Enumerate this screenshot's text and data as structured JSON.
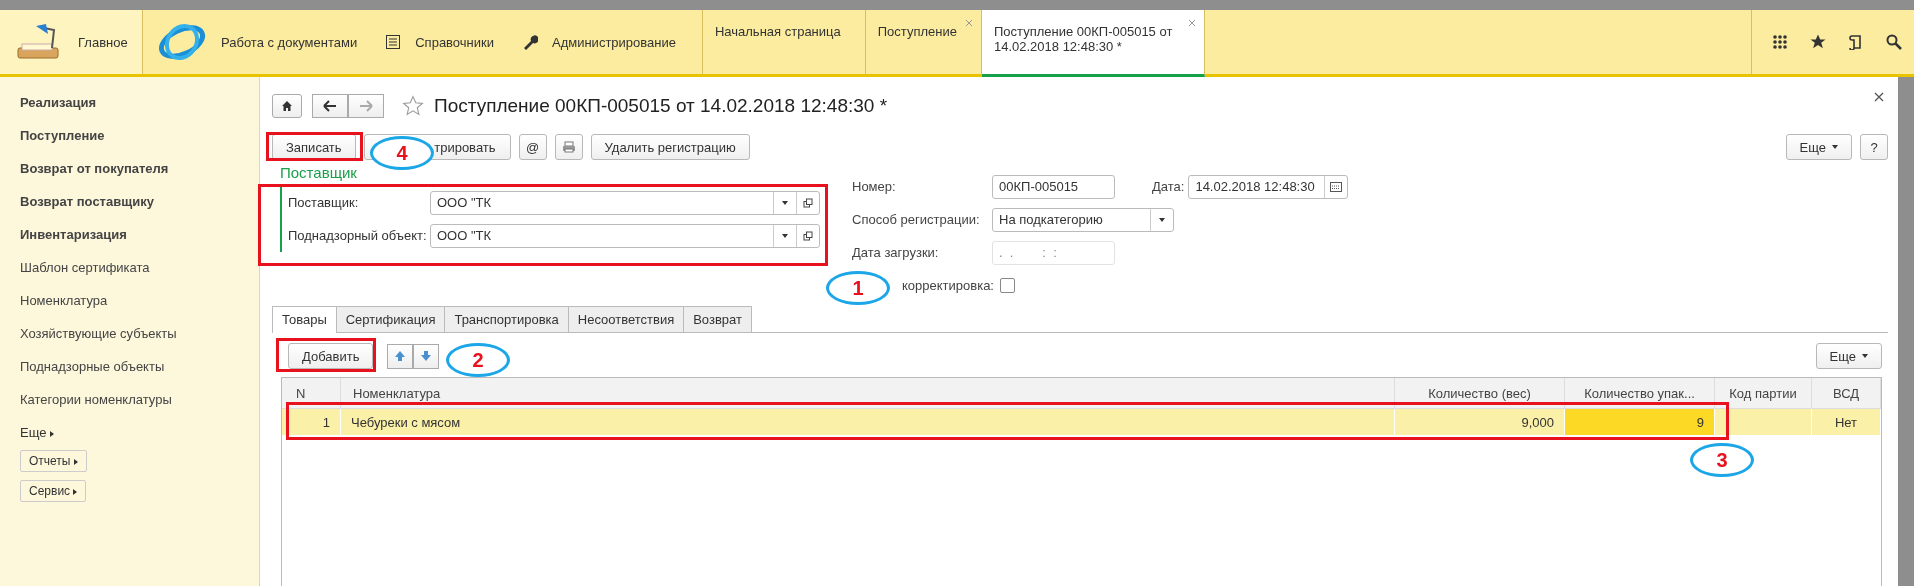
{
  "top_bar": {
    "sections": [
      {
        "label": "Главное",
        "selected": true
      },
      {
        "label": "Работа с документами",
        "selected": false
      },
      {
        "label": "Справочники",
        "selected": false
      },
      {
        "label": "Администрирование",
        "selected": false
      }
    ],
    "open_tabs": [
      {
        "label": "Начальная страница",
        "selected": false,
        "closable": false
      },
      {
        "label": "Поступление",
        "selected": false,
        "closable": true
      },
      {
        "label": "Поступление 00КП-005015 от 14.02.2018 12:48:30 *",
        "selected": true,
        "closable": true
      }
    ]
  },
  "sidebar": {
    "items": [
      {
        "label": "Реализация",
        "bold": true
      },
      {
        "label": "Поступление",
        "bold": true
      },
      {
        "label": "Возврат от покупателя",
        "bold": true
      },
      {
        "label": "Возврат поставщику",
        "bold": true
      },
      {
        "label": "Инвентаризация",
        "bold": true
      },
      {
        "label": "Шаблон сертификата",
        "bold": false
      },
      {
        "label": "Номенклатура",
        "bold": false
      },
      {
        "label": "Хозяйствующие субъекты",
        "bold": false
      },
      {
        "label": "Поднадзорные объекты",
        "bold": false
      },
      {
        "label": "Категории номенклатуры",
        "bold": false
      }
    ],
    "more": "Еще",
    "buttons": [
      "Отчеты",
      "Сервис"
    ]
  },
  "document": {
    "title": "Поступление 00КП-005015 от 14.02.2018 12:48:30 *",
    "toolbar": [
      {
        "kind": "text",
        "label": "Записать"
      },
      {
        "kind": "text",
        "label": "трировать"
      },
      {
        "kind": "at",
        "label": "@"
      },
      {
        "kind": "print"
      },
      {
        "kind": "text",
        "label": "Удалить регистрацию"
      }
    ],
    "more": "Еще",
    "help": "?",
    "group_title": "Поставщик",
    "fields": [
      {
        "label": "Поставщик:",
        "value": "ООО \"ТК"
      },
      {
        "label": "Поднадзорный объект:",
        "value": "ООО \"ТК"
      }
    ],
    "number": {
      "label": "Номер:",
      "value": "00КП-005015"
    },
    "date": {
      "label": "Дата:",
      "value": "14.02.2018 12:48:30"
    },
    "registration": {
      "label": "Способ регистрации:",
      "value": "На подкатегорию"
    },
    "load_date": {
      "label": "Дата загрузки:",
      "placeholder": ".  .        :  :",
      "disabled": true
    },
    "correction": {
      "label": "корректировка:",
      "checked": false
    },
    "tabs": [
      {
        "label": "Товары",
        "selected": true
      },
      {
        "label": "Сертификация",
        "selected": false
      },
      {
        "label": "Транспортировка",
        "selected": false
      },
      {
        "label": "Несоответствия",
        "selected": false
      },
      {
        "label": "Возврат",
        "selected": false
      }
    ],
    "table_toolbar": {
      "add": "Добавить",
      "more": "Еще"
    },
    "table": {
      "columns": [
        "N",
        "Номенклатура",
        "Количество (вес)",
        "Количество упак...",
        "Код партии",
        "ВСД"
      ],
      "rows": [
        {
          "selected": true,
          "cells": [
            {
              "text": "1",
              "focused": false
            },
            {
              "text": "Чебуреки с мясом",
              "focused": false
            },
            {
              "text": "9,000",
              "focused": false
            },
            {
              "text": "9",
              "focused": true
            },
            {
              "focused": false
            },
            {
              "text": "Нет",
              "focused": false
            }
          ]
        }
      ]
    }
  },
  "annotations": [
    {
      "label": "4"
    },
    {
      "label": "1"
    },
    {
      "label": "2"
    },
    {
      "label": "3"
    }
  ]
}
